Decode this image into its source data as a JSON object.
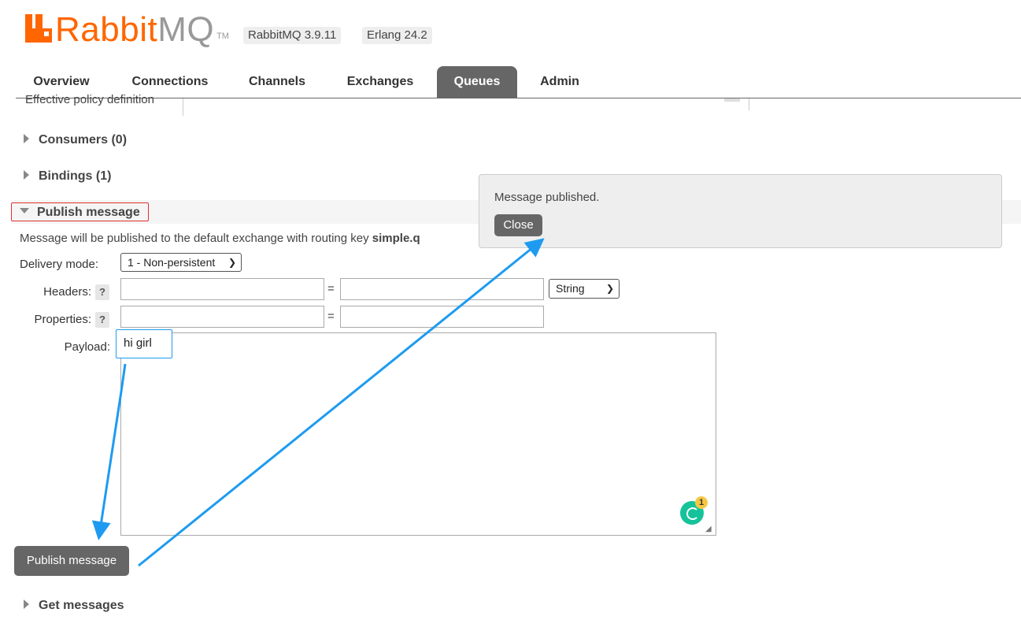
{
  "header": {
    "logo_text_a": "Rabbit",
    "logo_text_b": "MQ",
    "logo_tm": "TM",
    "version": "RabbitMQ 3.9.11",
    "erlang": "Erlang 24.2"
  },
  "tabs": [
    {
      "label": "Overview"
    },
    {
      "label": "Connections"
    },
    {
      "label": "Channels"
    },
    {
      "label": "Exchanges"
    },
    {
      "label": "Queues",
      "active": true
    },
    {
      "label": "Admin"
    }
  ],
  "partial_row": {
    "label": "Effective policy definition"
  },
  "sections": {
    "consumers": "Consumers (0)",
    "bindings": "Bindings (1)",
    "publish": "Publish message",
    "get": "Get messages"
  },
  "publish_form": {
    "info_prefix": "Message will be published to the default exchange with routing key ",
    "routing_key": "simple.q",
    "delivery_mode_label": "Delivery mode:",
    "delivery_mode_value": "1 - Non-persistent",
    "headers_label": "Headers:",
    "header_type_value": "String",
    "properties_label": "Properties:",
    "help": "?",
    "equals": "=",
    "payload_label": "Payload:",
    "payload_value": "hi girl",
    "submit_label": "Publish message"
  },
  "popup": {
    "message": "Message published.",
    "close_label": "Close"
  },
  "grammar_badge": {
    "count": "1"
  },
  "colors": {
    "brand_orange": "#ff6600",
    "tab_active_bg": "#666666",
    "annotation_blue": "#1e9bf0",
    "highlight_red": "#e03030"
  }
}
